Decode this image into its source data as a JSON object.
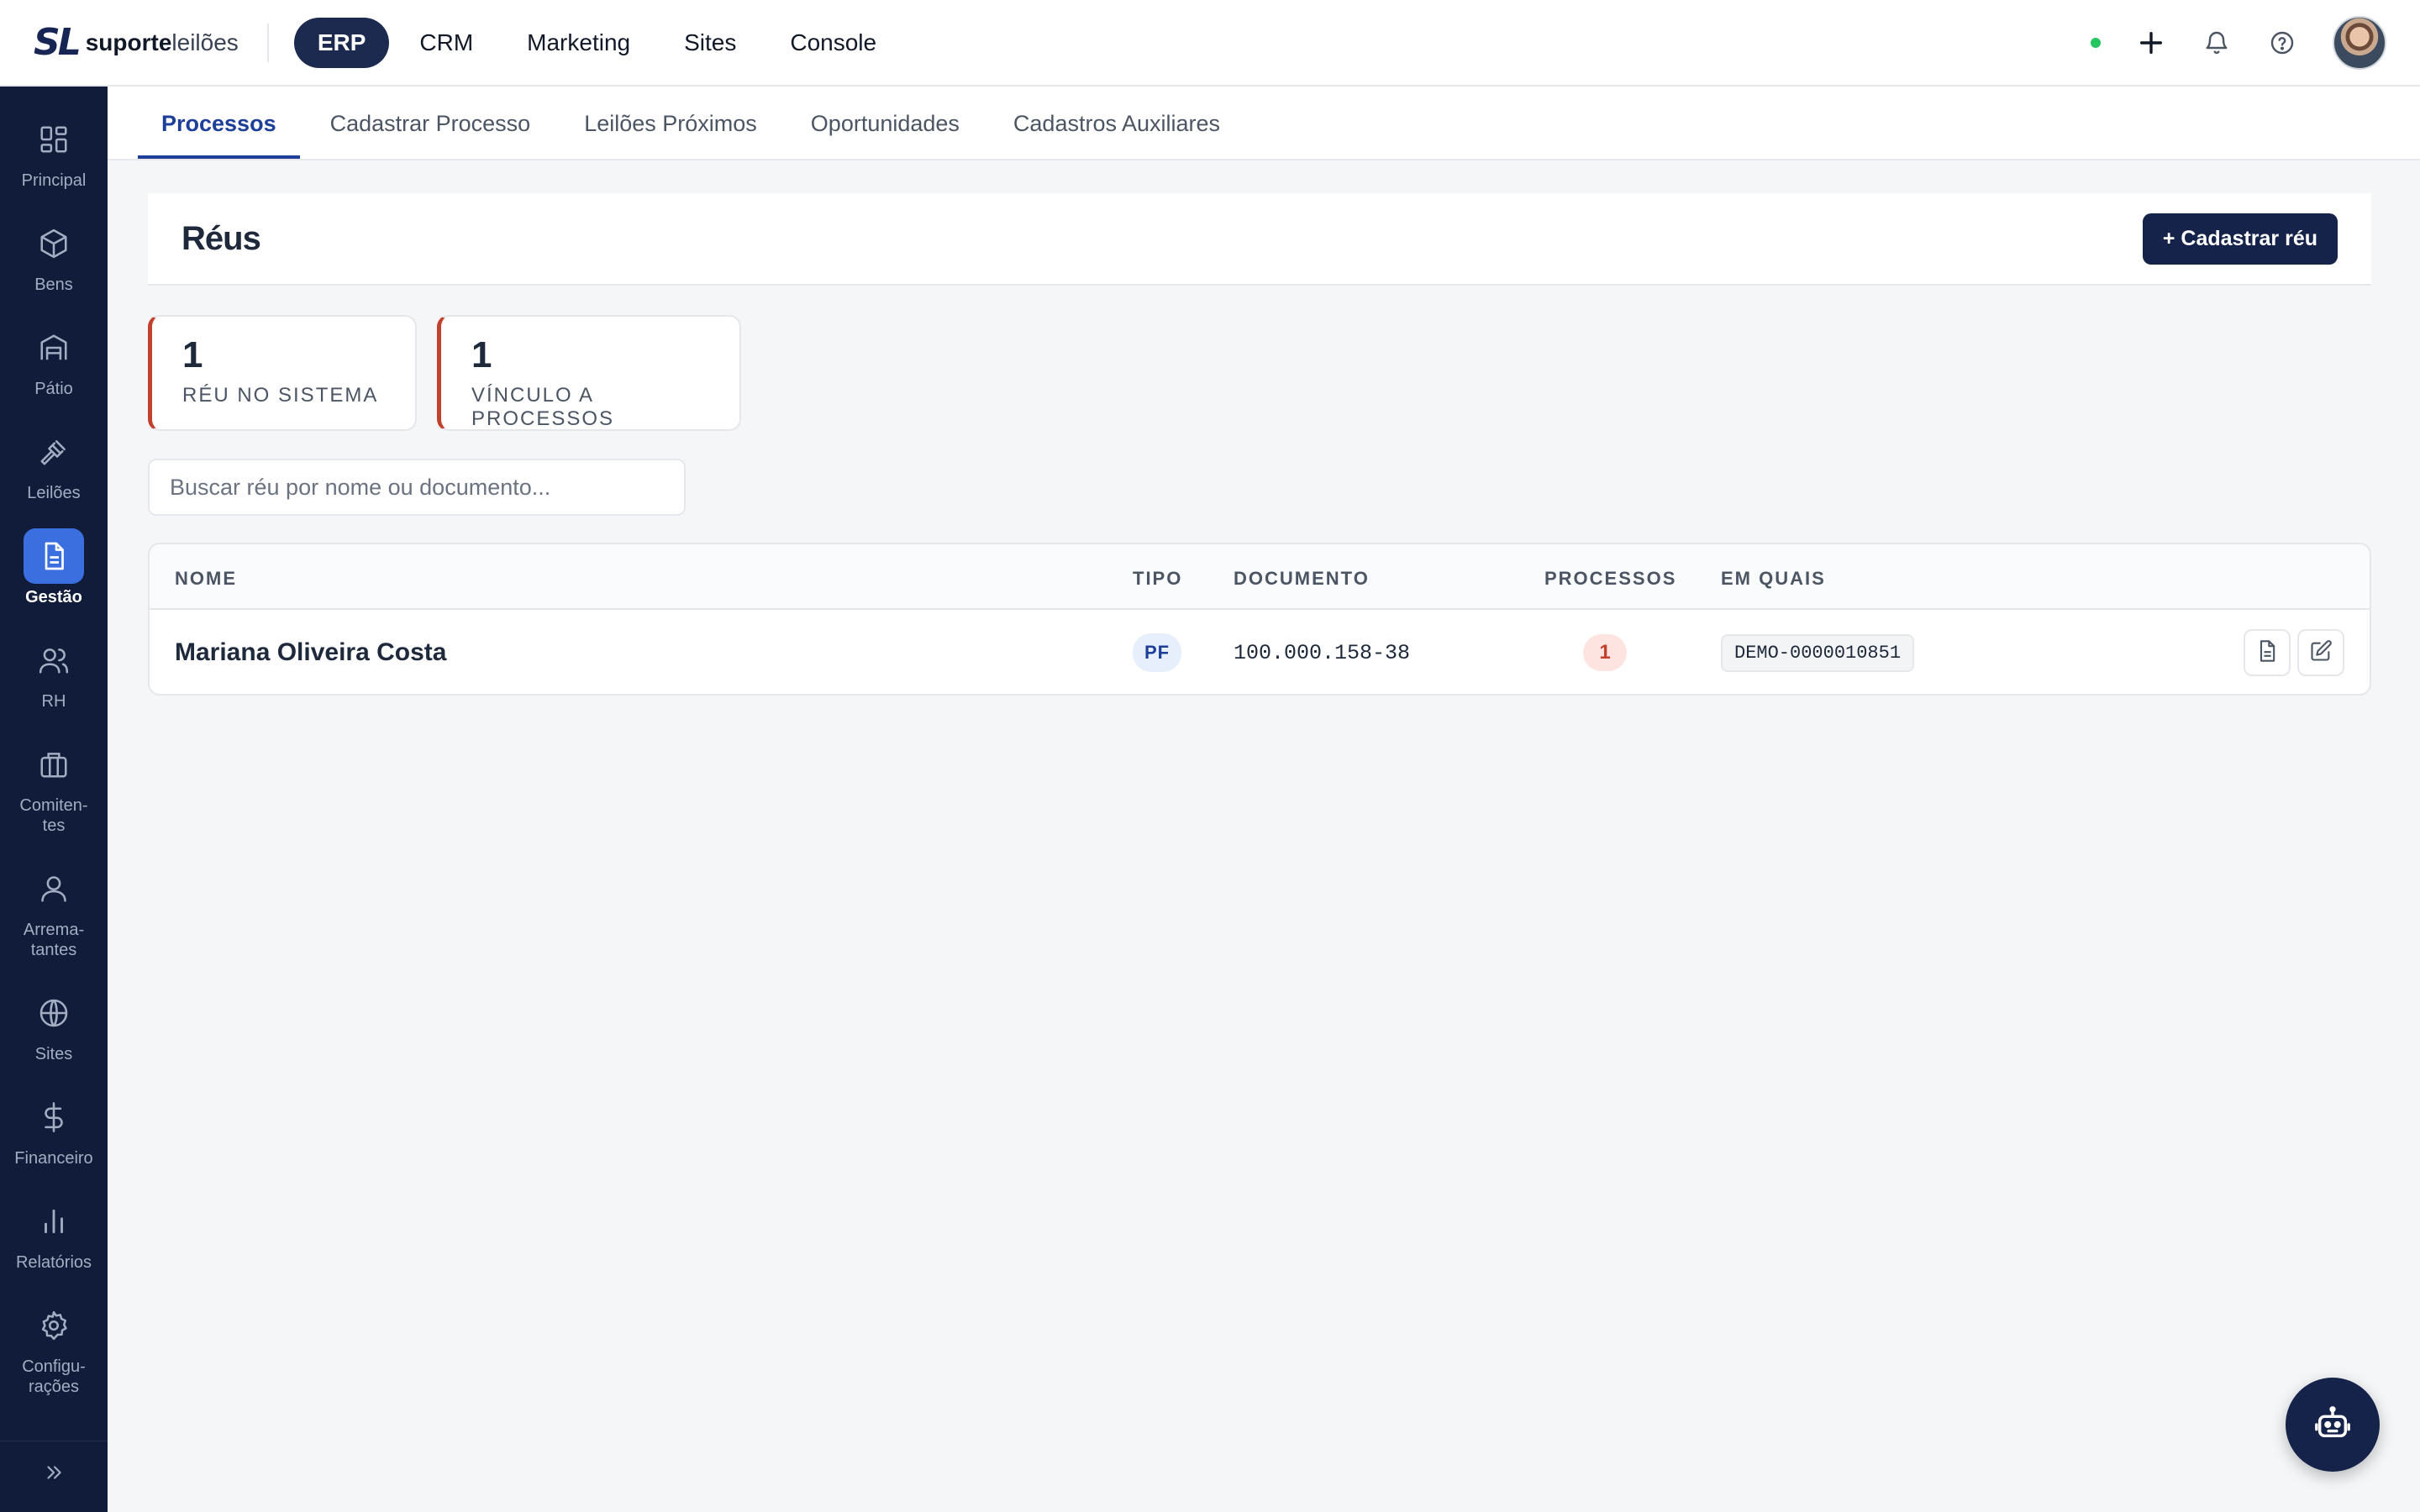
{
  "brand": {
    "mark": "SL",
    "name_bold": "suporte",
    "name_light": "leilões"
  },
  "top_nav": [
    {
      "label": "ERP",
      "active": true
    },
    {
      "label": "CRM",
      "active": false
    },
    {
      "label": "Marketing",
      "active": false
    },
    {
      "label": "Sites",
      "active": false
    },
    {
      "label": "Console",
      "active": false
    }
  ],
  "top_actions": {
    "status": "online",
    "icons": [
      "plus-icon",
      "bell-icon",
      "help-icon",
      "user-avatar"
    ]
  },
  "sidebar": {
    "items": [
      {
        "label": "Principal",
        "icon": "grid-icon",
        "active": false
      },
      {
        "label": "Bens",
        "icon": "cube-icon",
        "active": false
      },
      {
        "label": "Pátio",
        "icon": "warehouse-icon",
        "active": false
      },
      {
        "label": "Leilões",
        "icon": "gavel-icon",
        "active": false
      },
      {
        "label": "Gestão",
        "icon": "document-icon",
        "active": true
      },
      {
        "label": "RH",
        "icon": "users-icon",
        "active": false
      },
      {
        "label": "Comiten-\ntes",
        "icon": "briefcase-icon",
        "active": false
      },
      {
        "label": "Arrema-\ntantes",
        "icon": "user-icon",
        "active": false
      },
      {
        "label": "Sites",
        "icon": "globe-icon",
        "active": false
      },
      {
        "label": "Financeiro",
        "icon": "dollar-icon",
        "active": false
      },
      {
        "label": "Relatórios",
        "icon": "bar-chart-icon",
        "active": false
      },
      {
        "label": "Configu-\nrações",
        "icon": "gear-icon",
        "active": false
      }
    ],
    "expand_icon": "chevrons-right-icon"
  },
  "tabs": [
    {
      "label": "Processos",
      "active": true
    },
    {
      "label": "Cadastrar Processo",
      "active": false
    },
    {
      "label": "Leilões Próximos",
      "active": false
    },
    {
      "label": "Oportunidades",
      "active": false
    },
    {
      "label": "Cadastros Auxiliares",
      "active": false
    }
  ],
  "page": {
    "title": "Réus",
    "add_button": "+ Cadastrar réu"
  },
  "stats": [
    {
      "value": "1",
      "label": "RÉU NO SISTEMA"
    },
    {
      "value": "1",
      "label": "VÍNCULO A PROCESSOS"
    }
  ],
  "search": {
    "placeholder": "Buscar réu por nome ou documento...",
    "value": ""
  },
  "table": {
    "columns": [
      "NOME",
      "TIPO",
      "DOCUMENTO",
      "PROCESSOS",
      "EM QUAIS"
    ],
    "rows": [
      {
        "nome": "Mariana Oliveira Costa",
        "tipo": "PF",
        "documento": "100.000.158-38",
        "processos": "1",
        "em_quais": "DEMO-0000010851"
      }
    ],
    "row_actions": [
      "document-icon",
      "edit-icon"
    ]
  },
  "fab": {
    "icon": "robot-icon"
  },
  "colors": {
    "sidebar_bg": "#111c3a",
    "primary": "#15234a",
    "accent_blue": "#1d3f9a",
    "stat_border": "#c2412d",
    "status_online": "#22c55e"
  }
}
